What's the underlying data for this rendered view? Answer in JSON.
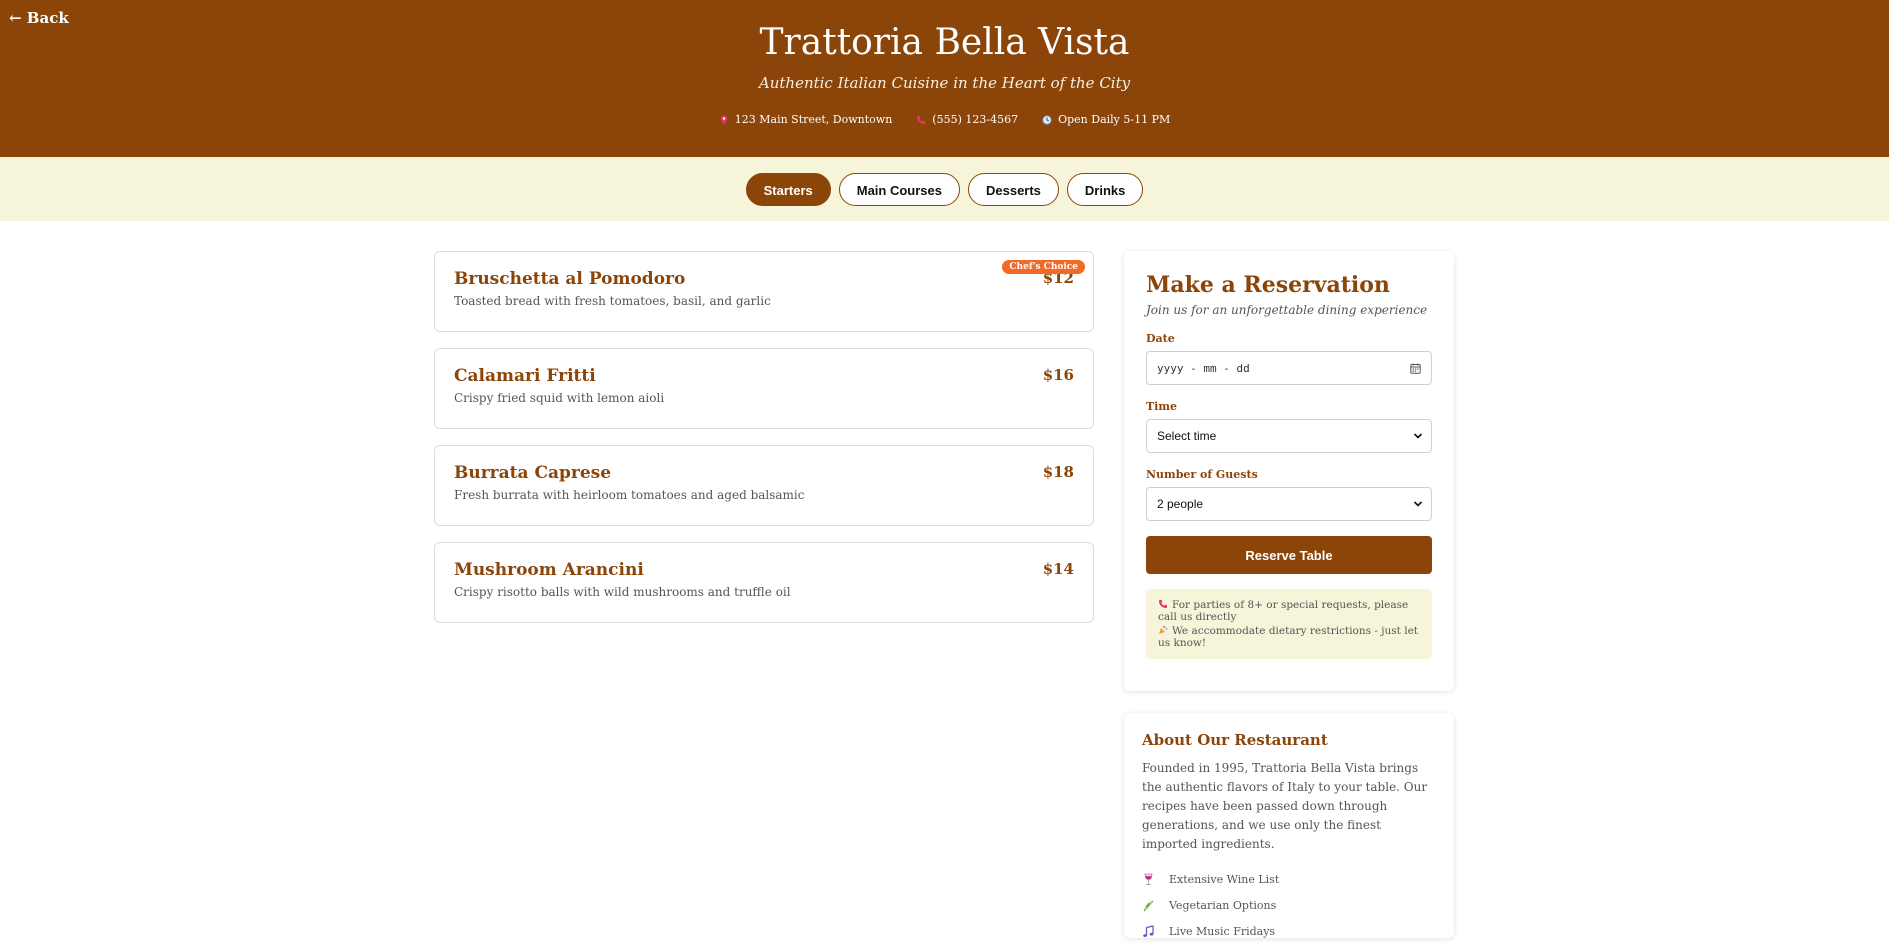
{
  "header": {
    "back_label": "← Back",
    "title": "Trattoria Bella Vista",
    "tagline": "Authentic Italian Cuisine in the Heart of the City",
    "address": "123 Main Street, Downtown",
    "phone": "(555) 123-4567",
    "hours": "Open Daily 5-11 PM"
  },
  "tabs": [
    {
      "label": "Starters",
      "active": true
    },
    {
      "label": "Main Courses",
      "active": false
    },
    {
      "label": "Desserts",
      "active": false
    },
    {
      "label": "Drinks",
      "active": false
    }
  ],
  "menu": {
    "items": [
      {
        "name": "Bruschetta al Pomodoro",
        "description": "Toasted bread with fresh tomatoes, basil, and garlic",
        "price": "$12",
        "badge": "Chef's Choice"
      },
      {
        "name": "Calamari Fritti",
        "description": "Crispy fried squid with lemon aioli",
        "price": "$16"
      },
      {
        "name": "Burrata Caprese",
        "description": "Fresh burrata with heirloom tomatoes and aged balsamic",
        "price": "$18"
      },
      {
        "name": "Mushroom Arancini",
        "description": "Crispy risotto balls with wild mushrooms and truffle oil",
        "price": "$14"
      }
    ]
  },
  "reservation": {
    "title": "Make a Reservation",
    "subtitle": "Join us for an unforgettable dining experience",
    "date_label": "Date",
    "date_placeholder": "yyyy - mm - dd",
    "time_label": "Time",
    "time_value": "Select time",
    "guests_label": "Number of Guests",
    "guests_value": "2 people",
    "button_label": "Reserve Table",
    "note_1": "For parties of 8+ or special requests, please call us directly",
    "note_2": "We accommodate dietary restrictions - just let us know!"
  },
  "about": {
    "title": "About Our Restaurant",
    "text": "Founded in 1995, Trattoria Bella Vista brings the authentic flavors of Italy to your table. Our recipes have been passed down through generations, and we use only the finest imported ingredients.",
    "features": [
      {
        "label": "Extensive Wine List",
        "icon": "wine-glass-icon"
      },
      {
        "label": "Vegetarian Options",
        "icon": "herb-icon"
      },
      {
        "label": "Live Music Fridays",
        "icon": "music-note-icon"
      }
    ]
  },
  "colors": {
    "brand": "#8b4509",
    "cream": "#f6f4d9",
    "badge": "#f46a25"
  }
}
